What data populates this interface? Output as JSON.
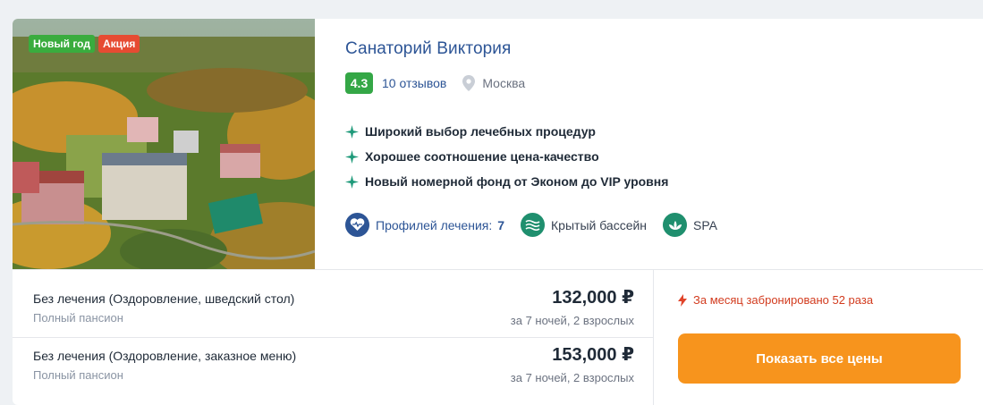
{
  "badges": {
    "new_year": "Новый год",
    "promo": "Акция"
  },
  "hotel": {
    "title": "Санаторий Виктория",
    "rating": "4.3",
    "reviews": "10 отзывов",
    "city": "Москва"
  },
  "features": [
    "Широкий выбор лечебных процедур",
    "Хорошее соотношение цена-качество",
    "Новый номерной фонд от Эконом до VIP уровня"
  ],
  "amenities": {
    "profiles_label": "Профилей лечения:",
    "profiles_count": "7",
    "pool": "Крытый бассейн",
    "spa": "SPA",
    "icons": [
      "heart-pulse-icon",
      "waves-icon",
      "lotus-icon"
    ]
  },
  "offers": [
    {
      "name": "Без лечения (Оздоровление, шведский стол)",
      "board": "Полный пансион",
      "price": "132,000 ₽",
      "per": "за 7 ночей, 2 взрослых"
    },
    {
      "name": "Без лечения (Оздоровление, заказное меню)",
      "board": "Полный пансион",
      "price": "153,000 ₽",
      "per": "за 7 ночей, 2 взрослых"
    }
  ],
  "booking": {
    "notice": "За месяц забронировано 52 раза",
    "cta": "Показать все цены"
  },
  "colors": {
    "accent": "#2d5596",
    "rating": "#34a746",
    "cta": "#f7941d",
    "alert": "#d23b1e",
    "feature_star": "#1f9a7a"
  }
}
